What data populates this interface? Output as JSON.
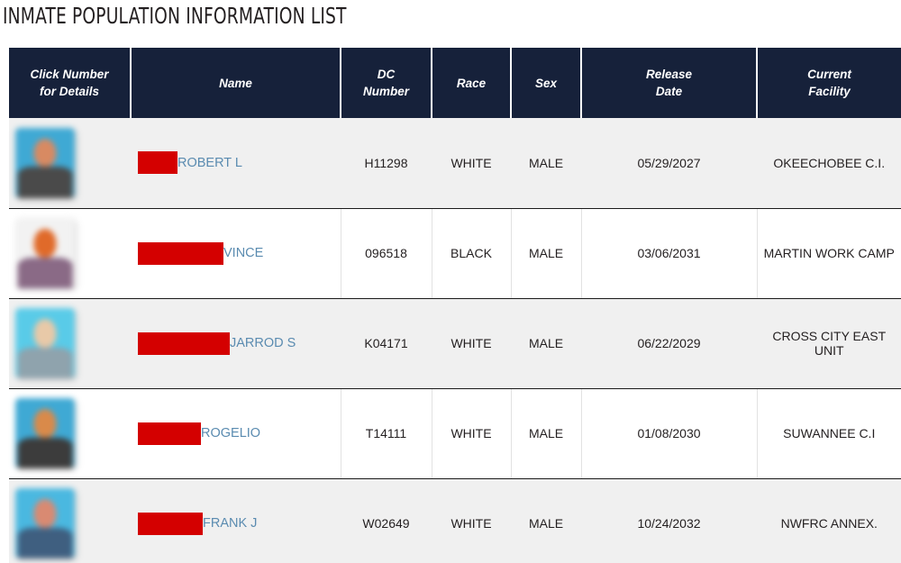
{
  "page": {
    "title": "INMATE POPULATION INFORMATION LIST"
  },
  "table": {
    "columns": [
      {
        "key": "photo",
        "label_line1": "Click Number",
        "label_line2": "for Details"
      },
      {
        "key": "name",
        "label_line1": "Name",
        "label_line2": ""
      },
      {
        "key": "dc",
        "label_line1": "DC",
        "label_line2": "Number"
      },
      {
        "key": "race",
        "label_line1": "Race",
        "label_line2": ""
      },
      {
        "key": "sex",
        "label_line1": "Sex",
        "label_line2": ""
      },
      {
        "key": "release",
        "label_line1": "Release",
        "label_line2": "Date"
      },
      {
        "key": "facility",
        "label_line1": "Current",
        "label_line2": "Facility"
      }
    ],
    "rows": [
      {
        "name": "ROBERT L",
        "redaction_width": 44,
        "dc_number": "H11298",
        "race": "WHITE",
        "sex": "MALE",
        "release_date": "05/29/2027",
        "facility": "OKEECHOBEE C.I.",
        "photo": {
          "bg": "#3fa9d4",
          "head": "#d88a62",
          "body": "#4a4a4a"
        }
      },
      {
        "name": "VINCE",
        "redaction_width": 95,
        "dc_number": "096518",
        "race": "BLACK",
        "sex": "MALE",
        "release_date": "03/06/2031",
        "facility": "MARTIN WORK CAMP",
        "photo": {
          "bg": "#f2f2f2",
          "head": "#e06a2a",
          "body": "#8a6a86"
        }
      },
      {
        "name": "JARROD S",
        "redaction_width": 102,
        "dc_number": "K04171",
        "race": "WHITE",
        "sex": "MALE",
        "release_date": "06/22/2029",
        "facility": "CROSS CITY EAST UNIT",
        "photo": {
          "bg": "#59cbe8",
          "head": "#e8c9a8",
          "body": "#8fa3ad"
        }
      },
      {
        "name": "ROGELIO",
        "redaction_width": 70,
        "dc_number": "T14111",
        "race": "WHITE",
        "sex": "MALE",
        "release_date": "01/08/2030",
        "facility": "SUWANNEE C.I",
        "photo": {
          "bg": "#3fa9d4",
          "head": "#d98a4a",
          "body": "#3c3c3c"
        }
      },
      {
        "name": "FRANK J",
        "redaction_width": 72,
        "dc_number": "W02649",
        "race": "WHITE",
        "sex": "MALE",
        "release_date": "10/24/2032",
        "facility": "NWFRC ANNEX.",
        "photo": {
          "bg": "#4ab8e0",
          "head": "#d98a72",
          "body": "#3f5f80"
        }
      }
    ]
  },
  "colors": {
    "header_bg": "#16213a",
    "header_text": "#ffffff",
    "redaction": "#d40000",
    "name_link": "#5a8bb0",
    "row_alt_bg": "#f0f0f0",
    "row_plain_bg": "#ffffff",
    "body_text": "#231f20"
  }
}
